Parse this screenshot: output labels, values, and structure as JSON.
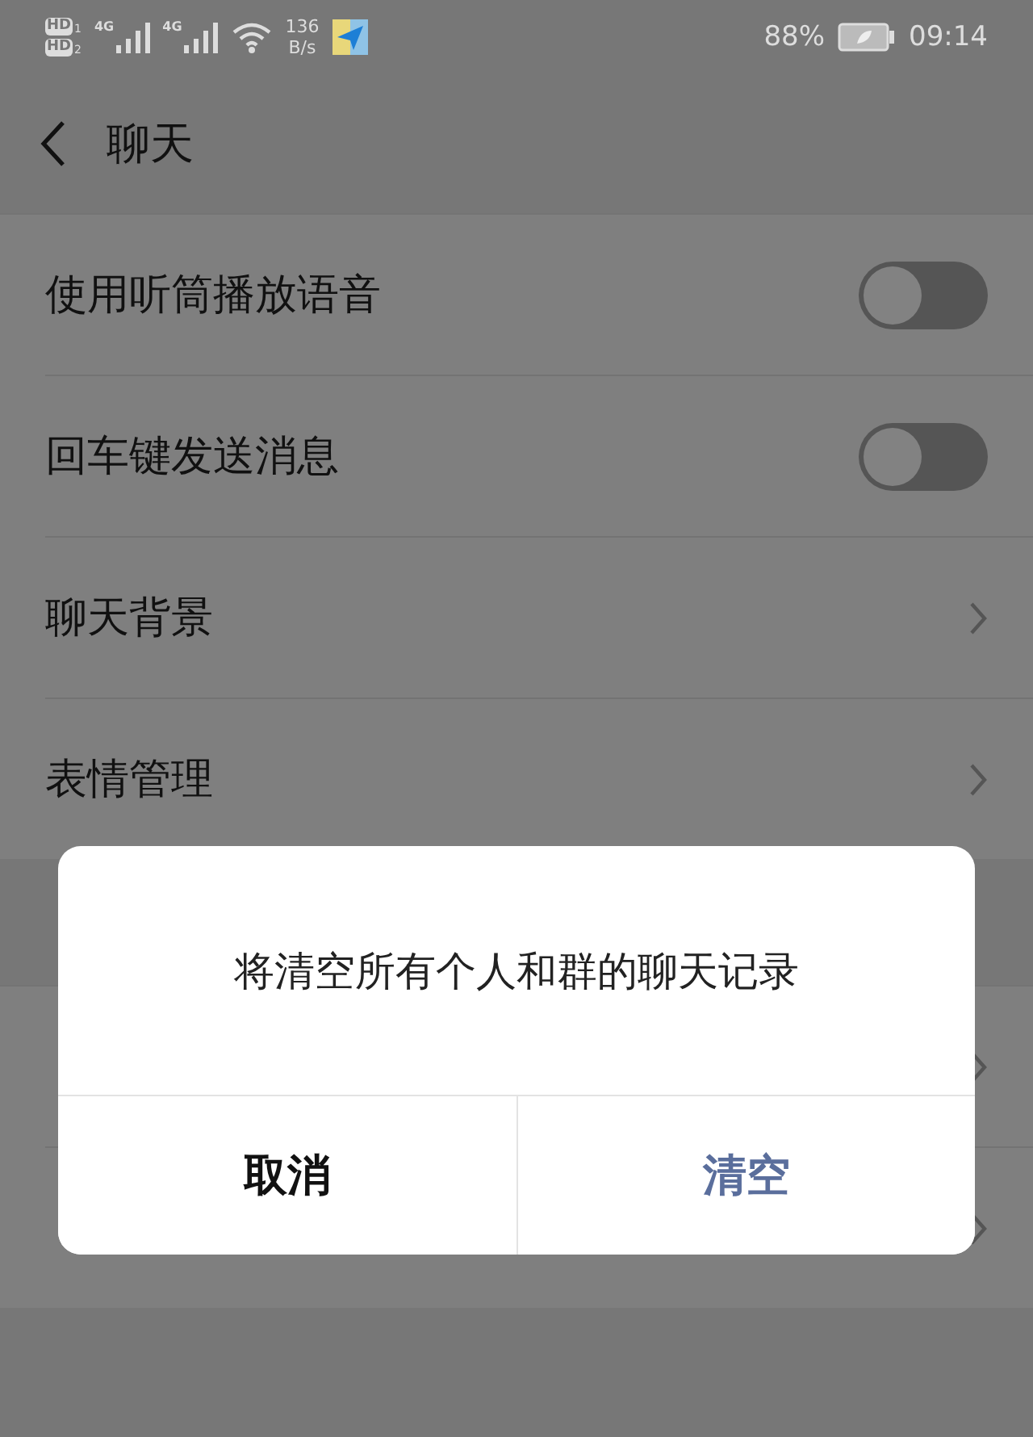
{
  "status_bar": {
    "sims": [
      {
        "badge": "HD",
        "slot": "1",
        "network": "4G"
      },
      {
        "badge": "HD",
        "slot": "2",
        "network": "4G"
      }
    ],
    "speed": [
      "136",
      "B/s"
    ],
    "battery": "88%",
    "time": "09:14"
  },
  "header": {
    "title": "聊天"
  },
  "settings": [
    {
      "kind": "toggle",
      "label": "使用听筒播放语音",
      "on": false
    },
    {
      "kind": "toggle",
      "label": "回车键发送消息",
      "on": false
    },
    {
      "kind": "link",
      "label": "聊天背景"
    },
    {
      "kind": "link",
      "label": "表情管理"
    }
  ],
  "dialog": {
    "message": "将清空所有个人和群的聊天记录",
    "buttons": [
      {
        "label": "取消",
        "kind": "cancel"
      },
      {
        "label": "清空",
        "kind": "confirm"
      }
    ]
  }
}
